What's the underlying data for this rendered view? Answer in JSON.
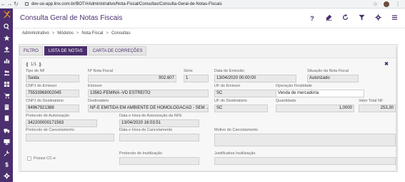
{
  "browser": {
    "url": "dev-ux-app.linx.com.br/BOT/#Administrativo/Nota-Fiscal/Consultas/Consulta-Geral-de-Notas-Fiscais"
  },
  "app": {
    "title": "Consulta Geral de Notas Fiscais",
    "header_actions": [
      "help-icon",
      "eraser-icon",
      "refresh-icon",
      "filter-icon",
      "settings-icon",
      "menu-icon"
    ],
    "help_label": "?"
  },
  "breadcrumb": {
    "items": [
      "Administrativo",
      "Módulos",
      "Nota Fiscal",
      "Consultas"
    ],
    "separator": ">"
  },
  "sidebar": {
    "brand_color": "#4b2f6e",
    "items": [
      "search-icon",
      "star-icon",
      "upload-icon",
      "chart-icon",
      "people-icon",
      "grid-icon",
      "cart-icon",
      "building-icon",
      "receipt-icon",
      "truck-icon",
      "monitor-icon",
      "wrench-icon",
      "dollar-icon",
      "gear-icon"
    ]
  },
  "tabs": [
    {
      "label": "FILTRO",
      "active": false
    },
    {
      "label": "LISTA DE NOTAS",
      "active": true
    },
    {
      "label": "CARTA DE CORREÇÕES",
      "active": false
    }
  ],
  "pager": {
    "text": "1/1"
  },
  "form": {
    "tipo_nf": {
      "label": "Tipo de NF",
      "value": "Saída"
    },
    "nota_fiscal": {
      "label": "Nº Nota Fiscal",
      "value": "902.607"
    },
    "serie": {
      "label": "Série",
      "value": "1"
    },
    "data_emissao": {
      "label": "Data de Emissão",
      "value": "13/04/2020 00:00:00"
    },
    "situacao": {
      "label": "Situação da Nota Fiscal",
      "value": "Autorizado"
    },
    "cnpj_emissor": {
      "label": "CNPJ do Emissor",
      "value": "75533968002045"
    },
    "emissor": {
      "label": "Emissor",
      "value": "13562-FEMINA -VD ESTREITO"
    },
    "uf_emissor": {
      "label": "UF do Emissor",
      "value": "SC"
    },
    "operacao": {
      "label": "Operação Finalidade",
      "value": "Venda de mercadoria"
    },
    "cnpj_destinatario": {
      "label": "CNPJ do Destinatário",
      "value": "94967921388"
    },
    "destinatario": {
      "label": "Destinatário",
      "value": "NF-E EMITIDA EM AMBIENTE DE HOMOLOGACAO - SEM ..."
    },
    "uf_destinatario": {
      "label": "UF do Destinatário",
      "value": "SC"
    },
    "quantidade": {
      "label": "Quantidade",
      "value": "1,0000"
    },
    "valor_total": {
      "label": "Valor Total NF",
      "value": "253,30"
    },
    "protocolo_autorizacao": {
      "label": "Protocolo de Autorização",
      "value": "342200000171563"
    },
    "data_autorizacao": {
      "label": "Data e Hora de Autorização da NFE",
      "value": "13/04/2020 16:03:51"
    },
    "protocolo_cancelamento": {
      "label": "Protocolo de Cancelamento",
      "value": ""
    },
    "data_cancelamento": {
      "label": "Data e Hora de Cancelamento",
      "value": ""
    },
    "motivo_cancelamento": {
      "label": "Motivo do Cancelamento",
      "value": ""
    },
    "protocolo_inutilizacao": {
      "label": "Protocolo de Inutilização",
      "value": ""
    },
    "justificativa_inutilizacao": {
      "label": "Justificativa Inutilização",
      "value": ""
    },
    "possui_cce": {
      "label": "Possui CC-e"
    }
  }
}
